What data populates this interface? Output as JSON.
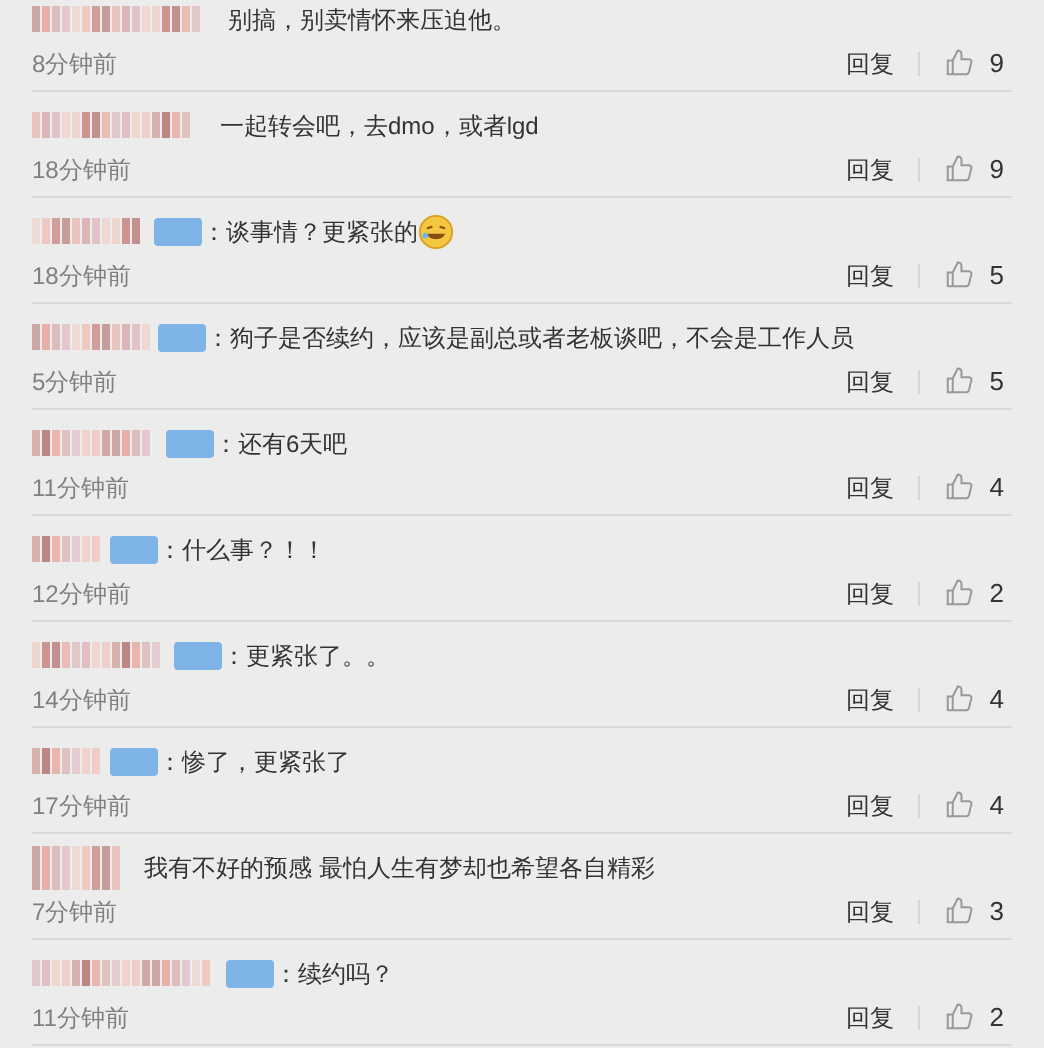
{
  "comments": [
    {
      "badge": false,
      "text": "别搞，别卖情怀来压迫他。",
      "emoji": false,
      "time": "8分钟前",
      "reply": "回复",
      "likes": "9"
    },
    {
      "badge": false,
      "text": "一起转会吧，去dmo，或者lgd",
      "emoji": false,
      "time": "18分钟前",
      "reply": "回复",
      "likes": "9"
    },
    {
      "badge": true,
      "text": "：谈事情？更紧张的",
      "emoji": true,
      "time": "18分钟前",
      "reply": "回复",
      "likes": "5"
    },
    {
      "badge": true,
      "text": "：狗子是否续约，应该是副总或者老板谈吧，不会是工作人员",
      "emoji": false,
      "time": "5分钟前",
      "reply": "回复",
      "likes": "5"
    },
    {
      "badge": true,
      "text": "：还有6天吧",
      "emoji": false,
      "time": "11分钟前",
      "reply": "回复",
      "likes": "4"
    },
    {
      "badge": true,
      "text": "：什么事？！！",
      "emoji": false,
      "time": "12分钟前",
      "reply": "回复",
      "likes": "2"
    },
    {
      "badge": true,
      "text": "：更紧张了。。",
      "emoji": false,
      "time": "14分钟前",
      "reply": "回复",
      "likes": "4"
    },
    {
      "badge": true,
      "text": "：惨了，更紧张了",
      "emoji": false,
      "time": "17分钟前",
      "reply": "回复",
      "likes": "4"
    },
    {
      "badge": false,
      "text": "我有不好的预感 最怕人生有梦却也希望各自精彩",
      "emoji": false,
      "time": "7分钟前",
      "reply": "回复",
      "likes": "3"
    },
    {
      "badge": true,
      "text": "：续约吗？",
      "emoji": false,
      "time": "11分钟前",
      "reply": "回复",
      "likes": "2"
    }
  ]
}
